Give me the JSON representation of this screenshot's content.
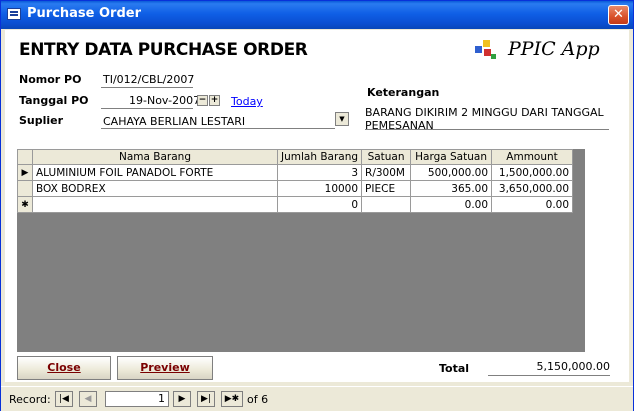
{
  "window": {
    "title": "Purchase Order"
  },
  "form": {
    "heading": "ENTRY DATA PURCHASE ORDER",
    "logo_text": "PPIC App",
    "fields": {
      "nomor_po_label": "Nomor PO",
      "nomor_po_value": "TI/012/CBL/2007",
      "tanggal_po_label": "Tanggal PO",
      "tanggal_po_value": "19-Nov-2007",
      "today_link": "Today",
      "suplier_label": "Suplier",
      "suplier_value": "CAHAYA BERLIAN LESTARI",
      "keterangan_label": "Keterangan",
      "keterangan_value": "BARANG DIKIRIM 2 MINGGU DARI TANGGAL PEMESANAN"
    },
    "grid": {
      "columns": [
        "Nama Barang",
        "Jumlah Barang",
        "Satuan",
        "Harga Satuan",
        "Ammount"
      ],
      "rows": [
        {
          "nama": "ALUMINIUM FOIL PANADOL FORTE",
          "jumlah": "3",
          "satuan": "R/300M",
          "harga": "500,000.00",
          "amount": "1,500,000.00"
        },
        {
          "nama": "BOX BODREX",
          "jumlah": "10000",
          "satuan": "PIECE",
          "harga": "365.00",
          "amount": "3,650,000.00"
        },
        {
          "nama": "",
          "jumlah": "0",
          "satuan": "",
          "harga": "0.00",
          "amount": "0.00"
        }
      ]
    },
    "buttons": {
      "close": "Close",
      "preview": "Preview"
    },
    "total_label": "Total",
    "total_value": "5,150,000.00"
  },
  "statusbar": {
    "record_label": "Record:",
    "current_record": "1",
    "of_text": "of  6"
  },
  "colors": {
    "titlebar": "#0a5bd8",
    "form_bg": "#ffffff",
    "grid_empty": "#808080",
    "link": "#0000ff"
  }
}
